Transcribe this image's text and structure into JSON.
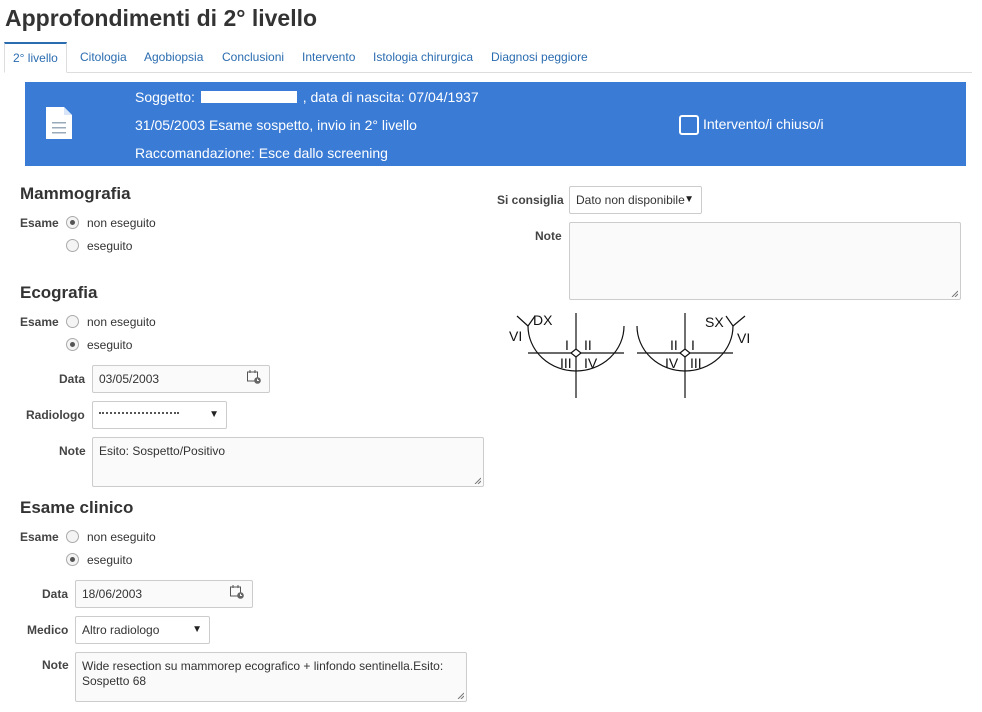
{
  "page_title": "Approfondimenti di 2° livello",
  "tabs": [
    "2° livello",
    "Citologia",
    "Agobiopsia",
    "Conclusioni",
    "Intervento",
    "Istologia chirurgica",
    "Diagnosi peggiore"
  ],
  "header": {
    "subject_label": "Soggetto:",
    "birth_text": ", data di nascita: 07/04/1937",
    "exam_line": "31/05/2003 Esame sospetto, invio in 2° livello",
    "recommendation": "Raccomandazione: Esce dallo screening",
    "checkbox_label": "Intervento/i chiuso/i"
  },
  "mammografia": {
    "title": "Mammografia",
    "esame_label": "Esame",
    "opt1": "non eseguito",
    "opt2": "eseguito"
  },
  "ecografia": {
    "title": "Ecografia",
    "esame_label": "Esame",
    "opt1": "non eseguito",
    "opt2": "eseguito",
    "data_label": "Data",
    "data_value": "03/05/2003",
    "radiologo_label": "Radiologo",
    "note_label": "Note",
    "note_value": "Esito: Sospetto/Positivo"
  },
  "esame_clinico": {
    "title": "Esame clinico",
    "esame_label": "Esame",
    "opt1": "non eseguito",
    "opt2": "eseguito",
    "data_label": "Data",
    "data_value": "18/06/2003",
    "medico_label": "Medico",
    "medico_value": "Altro radiologo",
    "note_label": "Note",
    "note_value": "Wide resection su mammorep ecografico + linfondo sentinella.Esito: Sospetto 68"
  },
  "right": {
    "consiglia_label": "Si consiglia",
    "consiglia_value": "Dato non disponibile",
    "note_label": "Note"
  },
  "diagram": {
    "dx": "DX",
    "sx": "SX",
    "q1": "I",
    "q2": "II",
    "q3": "III",
    "q4": "IV",
    "vi": "VI"
  }
}
